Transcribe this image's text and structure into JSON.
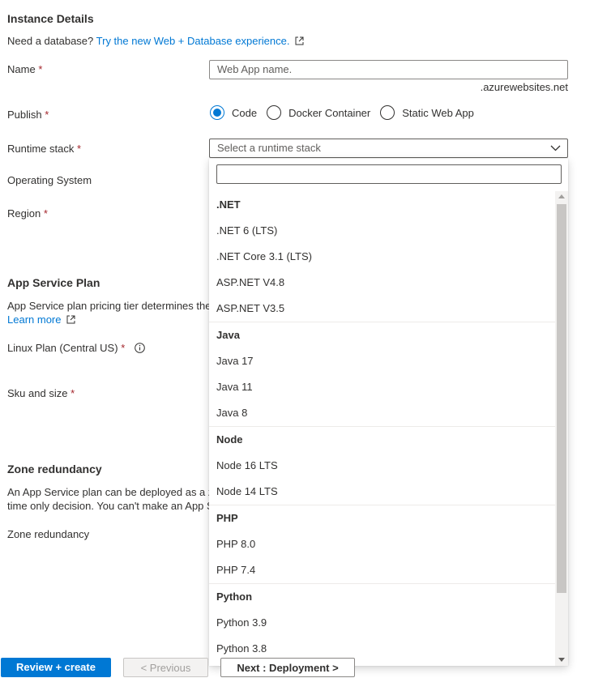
{
  "instance": {
    "heading": "Instance Details",
    "db_prompt": "Need a database?",
    "db_link": "Try the new Web + Database experience.",
    "name_label": "Name",
    "name_placeholder": "Web App name.",
    "domain_suffix": ".azurewebsites.net",
    "publish_label": "Publish",
    "publish_options": [
      {
        "label": "Code",
        "selected": true
      },
      {
        "label": "Docker Container",
        "selected": false
      },
      {
        "label": "Static Web App",
        "selected": false
      }
    ],
    "runtime_label": "Runtime stack",
    "runtime_placeholder": "Select a runtime stack",
    "os_label": "Operating System",
    "region_label": "Region"
  },
  "required_mark": "*",
  "plan": {
    "heading": "App Service Plan",
    "desc": "App Service plan pricing tier determines the",
    "learn_more": "Learn more",
    "linux_plan_label": "Linux Plan (Central US)",
    "sku_label": "Sku and size"
  },
  "zone": {
    "heading": "Zone redundancy",
    "desc_line1": "An App Service plan can be deployed as a z",
    "desc_line2": "time only decision. You can't make an App S",
    "label": "Zone redundancy"
  },
  "runtime_dropdown": {
    "groups": [
      {
        "name": ".NET",
        "options": [
          ".NET 6 (LTS)",
          ".NET Core 3.1 (LTS)",
          "ASP.NET V4.8",
          "ASP.NET V3.5"
        ]
      },
      {
        "name": "Java",
        "options": [
          "Java 17",
          "Java 11",
          "Java 8"
        ]
      },
      {
        "name": "Node",
        "options": [
          "Node 16 LTS",
          "Node 14 LTS"
        ]
      },
      {
        "name": "PHP",
        "options": [
          "PHP 8.0",
          "PHP 7.4"
        ]
      },
      {
        "name": "Python",
        "options": [
          "Python 3.9",
          "Python 3.8"
        ]
      }
    ]
  },
  "footer": {
    "review_create": "Review + create",
    "previous": "< Previous",
    "next": "Next : Deployment >"
  },
  "colors": {
    "accent": "#0078d4",
    "required": "#a4262c"
  }
}
